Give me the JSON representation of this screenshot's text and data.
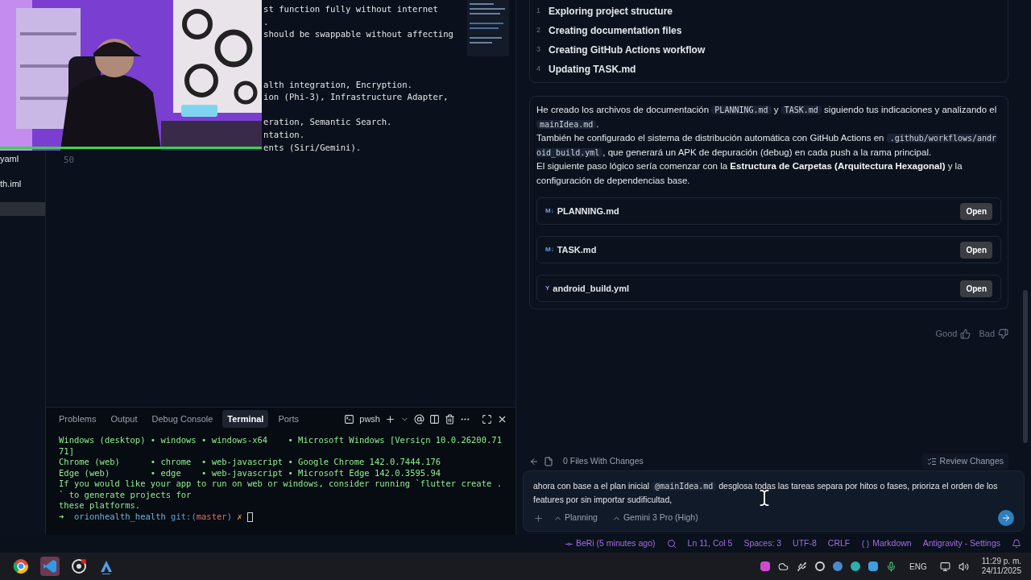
{
  "explorer": {
    "items": [
      {
        "label": "yaml",
        "selected": false
      },
      {
        "label": "th.iml",
        "selected": false
      },
      {
        "selected": true
      }
    ]
  },
  "editor": {
    "lines": [
      {
        "kind": "code",
        "text": "st function fully without internet"
      },
      {
        "kind": "code",
        "text": "."
      },
      {
        "kind": "code",
        "text": "should be swappable without affecting"
      },
      {
        "kind": "blank"
      },
      {
        "kind": "blank"
      },
      {
        "kind": "blank"
      },
      {
        "kind": "code",
        "text": "alth integration, Encryption."
      },
      {
        "kind": "code",
        "text": "ion (Phi-3), Infrastructure Adapter,"
      },
      {
        "kind": "blank"
      },
      {
        "kind": "code",
        "text": "eration, Semantic Search."
      },
      {
        "kind": "code",
        "text": "ntation."
      },
      {
        "kind": "code",
        "text": "ents (Siri/Gemini)."
      },
      {
        "kind": "number",
        "text": "50"
      }
    ]
  },
  "panel": {
    "tabs": [
      {
        "label": "Problems",
        "selected": false
      },
      {
        "label": "Output",
        "selected": false
      },
      {
        "label": "Debug Console",
        "selected": false
      },
      {
        "label": "Terminal",
        "selected": true
      },
      {
        "label": "Ports",
        "selected": false
      }
    ],
    "shell": "pwsh",
    "terminal_lines": [
      "Windows (desktop) • windows • windows-x64    • Microsoft Windows [Versiçn 10.0.26200.71",
      "71]",
      "Chrome (web)      • chrome  • web-javascript • Google Chrome 142.0.7444.176",
      "Edge (web)        • edge    • web-javascript • Microsoft Edge 142.0.3595.94",
      "If you would like your app to run on web or windows, consider running `flutter create .",
      "` to generate projects for",
      "these platforms."
    ],
    "prompt": {
      "arrow": "➜",
      "dir": "orionhealth_health",
      "git": "git:(",
      "branch": "master",
      "git_end": ")",
      "mark": "✗"
    }
  },
  "steps": [
    {
      "number": "1",
      "label": "Exploring project structure"
    },
    {
      "number": "2",
      "label": "Creating documentation files"
    },
    {
      "number": "3",
      "label": "Creating GitHub Actions workflow"
    },
    {
      "number": "4",
      "label": "Updating TASK.md"
    }
  ],
  "message": {
    "paragraphs": [
      [
        {
          "kind": "text",
          "text": "He creado los archivos de documentación "
        },
        {
          "kind": "code",
          "text": "PLANNING.md"
        },
        {
          "kind": "text",
          "text": " y "
        },
        {
          "kind": "code",
          "text": "TASK.md"
        },
        {
          "kind": "text",
          "text": " siguiendo tus indicaciones y analizando el "
        },
        {
          "kind": "code",
          "text": "mainIdea.md"
        },
        {
          "kind": "text",
          "text": "."
        }
      ],
      [
        {
          "kind": "text",
          "text": "También he configurado el sistema de distribución automática con GitHub Actions en "
        },
        {
          "kind": "code",
          "text": ".github/workflows/android_build.yml"
        },
        {
          "kind": "text",
          "text": ", que generará un APK de depuración (debug) en cada push a la rama principal."
        }
      ],
      [
        {
          "kind": "text",
          "text": "El siguiente paso lógico sería comenzar con la "
        },
        {
          "kind": "bold",
          "text": "Estructura de Carpetas (Arquitectura Hexagonal)"
        },
        {
          "kind": "text",
          "text": " y la configuración de dependencias base."
        }
      ]
    ],
    "files": [
      {
        "kind": "markdown",
        "badge": "M↓",
        "name": "PLANNING.md",
        "action": "Open"
      },
      {
        "kind": "markdown",
        "badge": "M↓",
        "name": "TASK.md",
        "action": "Open"
      },
      {
        "kind": "yaml",
        "badge": "Y",
        "name": "android_build.yml",
        "action": "Open"
      }
    ],
    "feedback": [
      "Good",
      "Bad"
    ]
  },
  "changes": {
    "label": "0 Files With Changes",
    "review": "Review Changes"
  },
  "input": {
    "segments": [
      {
        "kind": "text",
        "text": "ahora con base a el plan inicial "
      },
      {
        "kind": "mention",
        "text": "@mainIdea.md"
      },
      {
        "kind": "text",
        "text": "  desglosa todas las tareas separa por hitos o fases, prioriza el orden de los features por sin importar sudificultad,"
      }
    ],
    "mode": "Planning",
    "model": "Gemini 3 Pro (High)"
  },
  "status_bar": {
    "author": "BeRi (5 minutes ago)",
    "items": [
      "Ln 11, Col 5",
      "Spaces: 3",
      "UTF-8",
      "CRLF"
    ],
    "language": "Markdown",
    "settings": "Antigravity - Settings"
  },
  "taskbar": {
    "language": "ENG",
    "time": "11:29 p. m.",
    "date": "24/11/2025"
  }
}
